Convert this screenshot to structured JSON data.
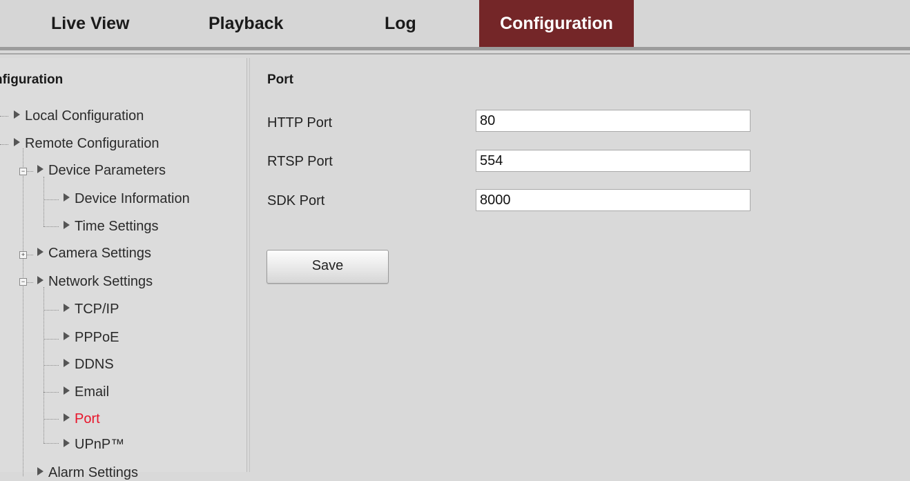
{
  "nav": {
    "tabs": [
      {
        "label": "Live View"
      },
      {
        "label": "Playback"
      },
      {
        "label": "Log"
      },
      {
        "label": "Configuration",
        "active": true
      }
    ],
    "active_color": "#742628"
  },
  "sidebar": {
    "title": "nfiguration",
    "items": [
      {
        "label": "Local Configuration"
      },
      {
        "label": "Remote Configuration"
      },
      {
        "label": "Device Parameters"
      },
      {
        "label": "Device Information"
      },
      {
        "label": "Time Settings"
      },
      {
        "label": "Camera Settings"
      },
      {
        "label": "Network Settings"
      },
      {
        "label": "TCP/IP"
      },
      {
        "label": "PPPoE"
      },
      {
        "label": "DDNS"
      },
      {
        "label": "Email"
      },
      {
        "label": "Port",
        "active": true
      },
      {
        "label": "UPnP™"
      },
      {
        "label": "Alarm Settings"
      }
    ],
    "active_color": "#e8142a"
  },
  "main": {
    "title": "Port",
    "fields": [
      {
        "label": "HTTP Port",
        "value": "80"
      },
      {
        "label": "RTSP Port",
        "value": "554"
      },
      {
        "label": "SDK Port",
        "value": "8000"
      }
    ],
    "save_label": "Save"
  }
}
